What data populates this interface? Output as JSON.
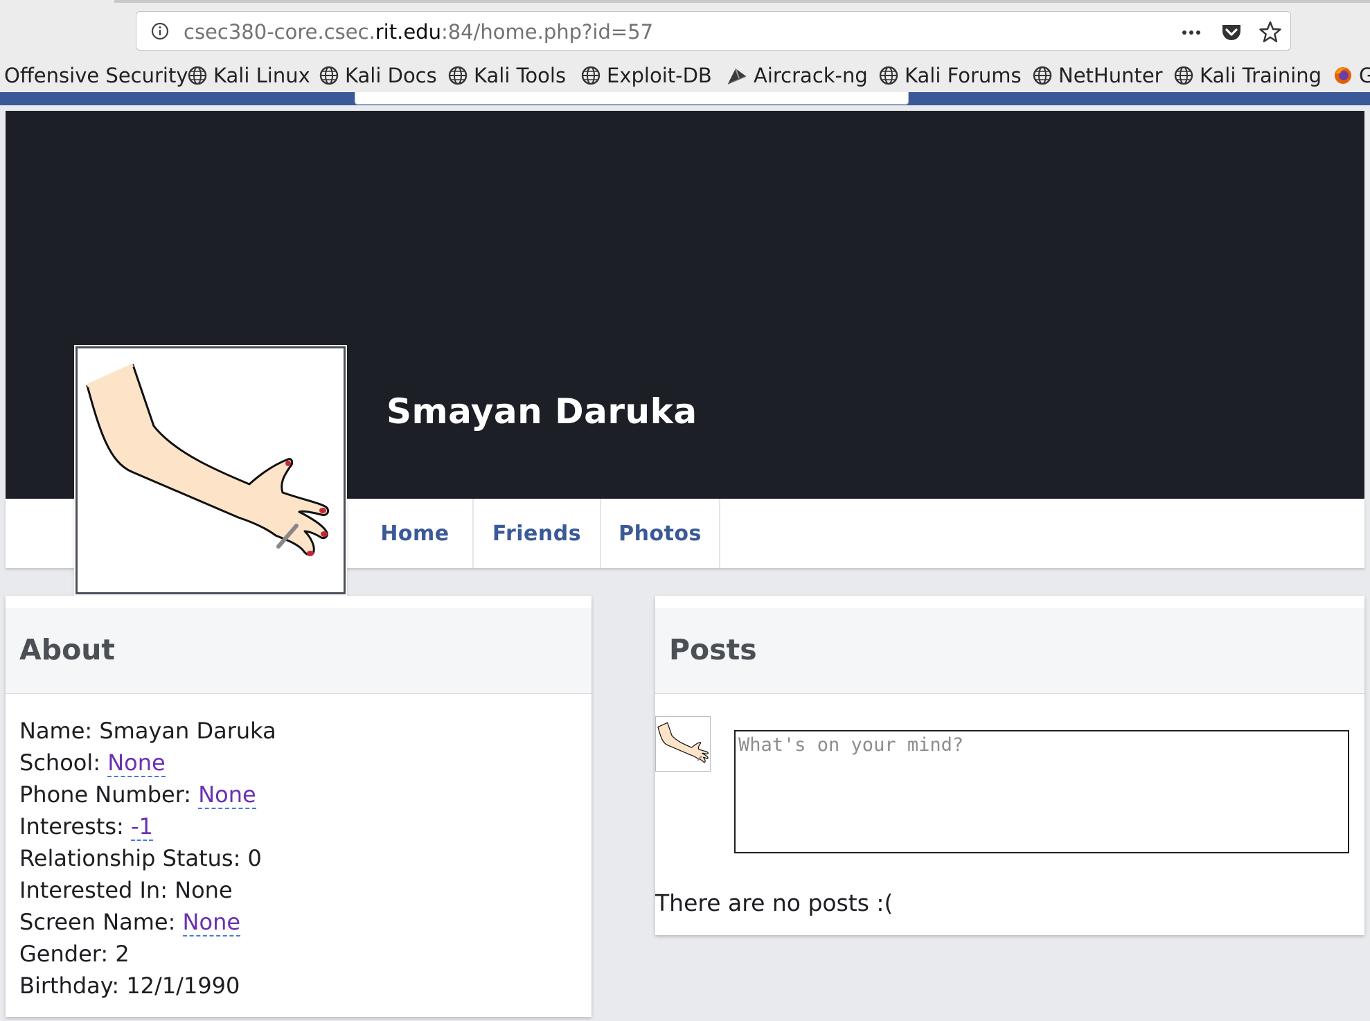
{
  "browser": {
    "url_prefix": "csec380-core.csec.",
    "url_domain": "rit.edu",
    "url_suffix": ":84/home.php?id=57",
    "icons": [
      "info-icon",
      "more-icon",
      "pocket-icon",
      "star-icon"
    ]
  },
  "bookmarks": [
    {
      "label": "Offensive Security",
      "icon": "none"
    },
    {
      "label": "Kali Linux",
      "icon": "globe-icon"
    },
    {
      "label": "Kali Docs",
      "icon": "globe-icon"
    },
    {
      "label": "Kali Tools",
      "icon": "globe-icon"
    },
    {
      "label": "Exploit-DB",
      "icon": "globe-icon"
    },
    {
      "label": "Aircrack-ng",
      "icon": "aircrack-icon"
    },
    {
      "label": "Kali Forums",
      "icon": "globe-icon"
    },
    {
      "label": "NetHunter",
      "icon": "globe-icon"
    },
    {
      "label": "Kali Training",
      "icon": "globe-icon"
    },
    {
      "label": "G",
      "icon": "firefox-icon"
    }
  ],
  "profile": {
    "name": "Smayan Daruka",
    "tabs": [
      "Home",
      "Friends",
      "Photos"
    ]
  },
  "about": {
    "title": "About",
    "fields": [
      {
        "label": "Name: ",
        "value": "Smayan Daruka",
        "link": false
      },
      {
        "label": "School: ",
        "value": "None",
        "link": true
      },
      {
        "label": "Phone Number: ",
        "value": "None",
        "link": true
      },
      {
        "label": "Interests: ",
        "value": "-1",
        "link": true
      },
      {
        "label": "Relationship Status: ",
        "value": "0",
        "link": false
      },
      {
        "label": "Interested In: ",
        "value": "None",
        "link": false
      },
      {
        "label": "Screen Name: ",
        "value": "None",
        "link": true
      },
      {
        "label": "Gender: ",
        "value": "2",
        "link": false
      },
      {
        "label": "Birthday: ",
        "value": "12/1/1990",
        "link": false
      }
    ]
  },
  "posts": {
    "title": "Posts",
    "placeholder": "What's on your mind?",
    "empty_message": "There are no posts :("
  },
  "colors": {
    "brand": "#3b5998",
    "cover": "#1d1f27",
    "link_value": "#6a2fb4"
  }
}
